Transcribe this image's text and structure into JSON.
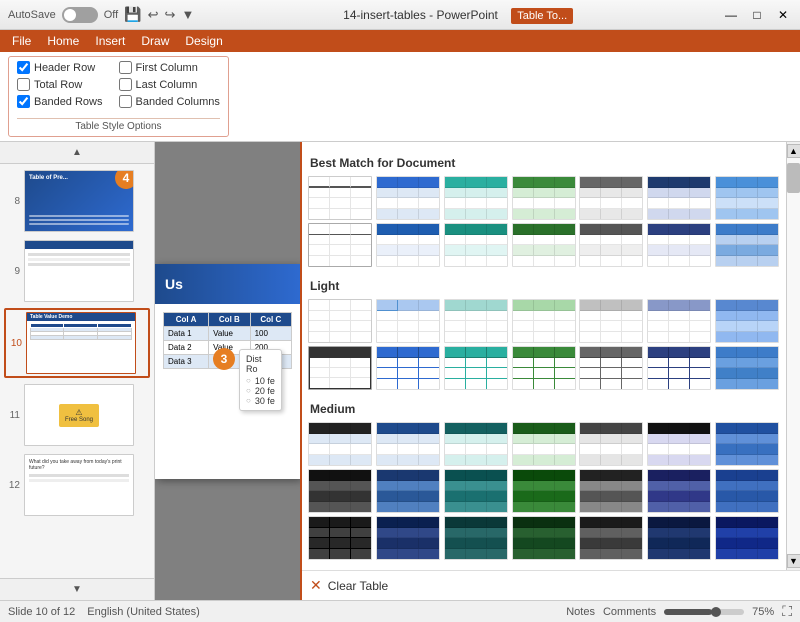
{
  "titleBar": {
    "autosave": "AutoSave",
    "autosaveState": "Off",
    "title": "14-insert-tables - PowerPoint",
    "ribbonTab": "Table To...",
    "undo": "↩",
    "redo": "↪",
    "minimize": "—",
    "maximize": "□",
    "close": "✕"
  },
  "menuBar": {
    "items": [
      "File",
      "Home",
      "Insert",
      "Draw",
      "Design"
    ]
  },
  "ribbon": {
    "sectionTitle": "Table Style Options",
    "checkboxes": {
      "headerRow": {
        "label": "Header Row",
        "checked": true
      },
      "firstColumn": {
        "label": "First Column",
        "checked": false
      },
      "totalRow": {
        "label": "Total Row",
        "checked": false
      },
      "lastColumn": {
        "label": "Last Column",
        "checked": false
      },
      "bandedRows": {
        "label": "Banded Rows",
        "checked": true
      },
      "bandedColumns": {
        "label": "Banded Columns",
        "checked": false
      }
    }
  },
  "slidePanel": {
    "slides": [
      {
        "num": "8",
        "active": false
      },
      {
        "num": "9",
        "active": false
      },
      {
        "num": "10",
        "active": true
      },
      {
        "num": "11",
        "active": false
      },
      {
        "num": "12",
        "active": false
      }
    ]
  },
  "canvas": {
    "title": "Us",
    "badgeNumber": "3",
    "tooltip": {
      "line1": "Dist",
      "line2": "Ro",
      "row1": "10 fe",
      "row2": "20 fe",
      "row3": "30 fe"
    },
    "badge4Label": "4"
  },
  "tableStylesPanel": {
    "sections": [
      {
        "key": "bestMatch",
        "title": "Best Match for Document",
        "styles": [
          {
            "key": "plain",
            "type": "plain"
          },
          {
            "key": "blue1",
            "type": "header-blue"
          },
          {
            "key": "teal1",
            "type": "header-teal"
          },
          {
            "key": "green1",
            "type": "header-green"
          },
          {
            "key": "gray1",
            "type": "header-gray"
          },
          {
            "key": "darkblue1",
            "type": "header-darkblue"
          },
          {
            "key": "blue2",
            "type": "banded-blue"
          },
          {
            "key": "plain2",
            "type": "plain2"
          },
          {
            "key": "blue3",
            "type": "header-blue2"
          },
          {
            "key": "teal2",
            "type": "header-teal2"
          },
          {
            "key": "green2",
            "type": "header-green2"
          },
          {
            "key": "gray2",
            "type": "header-gray2"
          },
          {
            "key": "darkblue2",
            "type": "header-darkblue2"
          },
          {
            "key": "blue4",
            "type": "banded-blue2"
          }
        ]
      },
      {
        "key": "light",
        "title": "Light",
        "styles": [
          {
            "key": "l1",
            "type": "light-plain"
          },
          {
            "key": "l2",
            "type": "light-blue"
          },
          {
            "key": "l3",
            "type": "light-teal"
          },
          {
            "key": "l4",
            "type": "light-green"
          },
          {
            "key": "l5",
            "type": "light-gray"
          },
          {
            "key": "l6",
            "type": "light-darkblue"
          },
          {
            "key": "l7",
            "type": "light-blue2"
          },
          {
            "key": "l8",
            "type": "light-dark"
          },
          {
            "key": "l9",
            "type": "light-blue3"
          },
          {
            "key": "l10",
            "type": "light-teal2"
          },
          {
            "key": "l11",
            "type": "light-green2"
          },
          {
            "key": "l12",
            "type": "light-gray2"
          },
          {
            "key": "l13",
            "type": "light-dark2"
          },
          {
            "key": "l14",
            "type": "light-blue4"
          }
        ]
      },
      {
        "key": "medium",
        "title": "Medium",
        "styles": [
          {
            "key": "m1",
            "type": "medium-dark1"
          },
          {
            "key": "m2",
            "type": "medium-blue1"
          },
          {
            "key": "m3",
            "type": "medium-teal1"
          },
          {
            "key": "m4",
            "type": "medium-green1"
          },
          {
            "key": "m5",
            "type": "medium-gray1"
          },
          {
            "key": "m6",
            "type": "medium-dark2"
          },
          {
            "key": "m7",
            "type": "medium-blue2"
          },
          {
            "key": "m8",
            "type": "medium-dark3"
          },
          {
            "key": "m9",
            "type": "medium-blue3"
          },
          {
            "key": "m10",
            "type": "medium-teal2"
          },
          {
            "key": "m11",
            "type": "medium-green2"
          },
          {
            "key": "m12",
            "type": "medium-gray2"
          },
          {
            "key": "m13",
            "type": "medium-dark4"
          },
          {
            "key": "m14",
            "type": "medium-blue4"
          },
          {
            "key": "m15",
            "type": "medium-dark5"
          },
          {
            "key": "m16",
            "type": "medium-blue5"
          },
          {
            "key": "m17",
            "type": "medium-teal3"
          },
          {
            "key": "m18",
            "type": "medium-green3"
          },
          {
            "key": "m19",
            "type": "medium-gray3"
          },
          {
            "key": "m20",
            "type": "medium-dark6"
          },
          {
            "key": "m21",
            "type": "medium-blue6"
          }
        ]
      }
    ],
    "clearTable": "Clear Table"
  },
  "bottomBar": {
    "slideInfo": "Slide 10 of 12",
    "language": "English (United States)",
    "zoom": "75%"
  }
}
